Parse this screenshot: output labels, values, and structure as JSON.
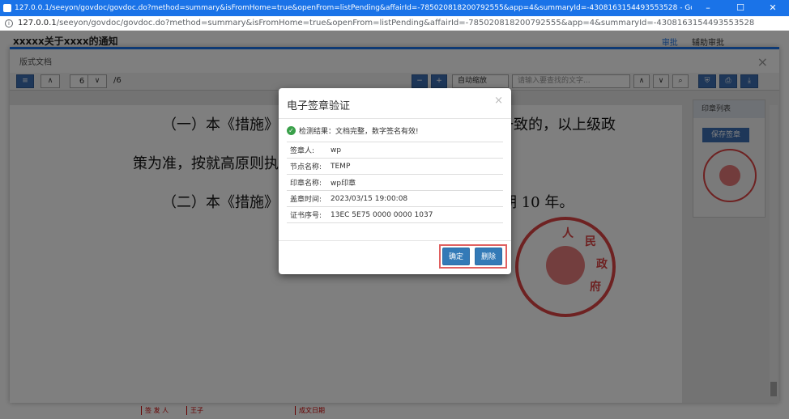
{
  "browser": {
    "window_title": "127.0.0.1/seeyon/govdoc/govdoc.do?method=summary&isFromHome=true&openFrom=listPending&affairId=-785020818200792555&app=4&summaryId=-4308163154493553528 - Google Chrome",
    "url_host": "127.0.0.1",
    "url_path": "/seeyon/govdoc/govdoc.do?method=summary&isFromHome=true&openFrom=listPending&affairId=-785020818200792555&app=4&summaryId=-4308163154493553528",
    "minimize": "–",
    "maximize": "☐",
    "close": "✕"
  },
  "page": {
    "doc_title": "xxxxx关于xxxx的通知",
    "link_review": "审批",
    "link_assist": "辅助审批"
  },
  "layout_window": {
    "title": "版式文档",
    "close": "×",
    "page_current": "6",
    "page_total": "/6",
    "zoom_value": "自动缩放",
    "search_placeholder": "请输入要查找的文字..."
  },
  "document": {
    "line1_left": "（一）本《措施》",
    "line1_right": "规定不一致的，以上级政",
    "line2": "策为准，按就高原则执",
    "line3_left": "（二）本《措施》",
    "line3_right": "期 10 年。"
  },
  "footer": {
    "signer_label": "签 发 人",
    "signer_value": "王子",
    "date_label": "成文日期"
  },
  "seal": {
    "char1": "人",
    "char2": "民",
    "char3": "政",
    "char4": "府"
  },
  "side_panel": {
    "title": "印章列表",
    "keep_button": "保存签章"
  },
  "modal": {
    "title": "电子签章验证",
    "close": "×",
    "check_result": "检测结果：文档完整，数字签名有效!",
    "rows": [
      {
        "label": "签章人:",
        "value": "wp"
      },
      {
        "label": "节点名称:",
        "value": "TEMP"
      },
      {
        "label": "印章名称:",
        "value": "wp印章"
      },
      {
        "label": "盖章时间:",
        "value": "2023/03/15 19:00:08"
      },
      {
        "label": "证书序号:",
        "value": "13EC 5E75 0000 0000 1037"
      }
    ],
    "confirm_button": "确定",
    "delete_button": "删除"
  },
  "colors": {
    "accent": "#1a73e8",
    "primary_button": "#337ab7",
    "seal_red": "#d44444",
    "highlight_red": "#e06060",
    "success_green": "#3aa04a"
  }
}
